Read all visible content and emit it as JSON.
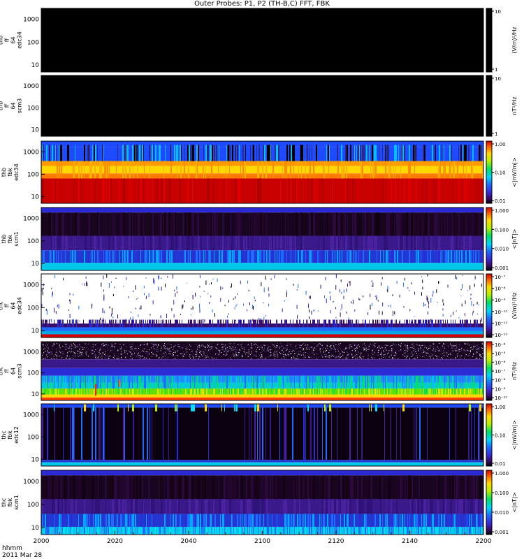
{
  "page": {
    "title": "Outer Probes: P1, P2 (TH-B,C) FFT, FBK"
  },
  "footer": {
    "hhmm_label": "hhmm",
    "date_label": "2011 Mar 28"
  },
  "chart_data": {
    "type": "heatmap",
    "x": {
      "label": "hhmm",
      "ticks": [
        "2000",
        "2020",
        "2040",
        "2100",
        "2120",
        "2140",
        "2200"
      ],
      "range_minutes": [
        0,
        120
      ]
    },
    "panels": [
      {
        "id": "tha-ff-edc34",
        "ylabel": [
          "thb",
          "ff",
          "64",
          "edc34"
        ],
        "yticks": [
          "1000",
          "100",
          "10"
        ],
        "ylog": true,
        "colorbar_label": "(V/m)²/Hz",
        "colorbar_ticks": [
          "10",
          "1"
        ],
        "colorbar_palette": "black",
        "style": "empty"
      },
      {
        "id": "thb-ff-scm3",
        "ylabel": [
          "thb",
          "ff",
          "64",
          "scm3"
        ],
        "yticks": [
          "1000",
          "100",
          "10"
        ],
        "ylog": true,
        "colorbar_label": "nT²/Hz",
        "colorbar_ticks": [
          "10",
          "1"
        ],
        "colorbar_palette": "black",
        "style": "empty"
      },
      {
        "id": "thb-fbk-edc34",
        "ylabel": [
          "thb",
          "fbk",
          "edc34"
        ],
        "yticks": [
          "1000",
          "100",
          "10"
        ],
        "ylog": true,
        "colorbar_label": "<|mV/m|>",
        "colorbar_ticks": [
          "1.00",
          "0.10",
          "0.01"
        ],
        "colorbar_palette": "rainbow",
        "style": "fbk_e",
        "bands": [
          {
            "name": "top",
            "color": "#1e4bff"
          },
          {
            "name": "stripe",
            "color": "#00c0ff"
          },
          {
            "name": "mid",
            "color": "#ff9a00"
          },
          {
            "name": "upper-mid",
            "color": "#ffd800"
          },
          {
            "name": "low",
            "color": "#d40000"
          }
        ]
      },
      {
        "id": "thb-fbk-scm1",
        "ylabel": [
          "thb",
          "fbk",
          "scm1"
        ],
        "yticks": [
          "1000",
          "100",
          "10"
        ],
        "ylog": true,
        "colorbar_label": "<|nT|>",
        "colorbar_ticks": [
          "1.000",
          "0.100",
          "0.010",
          "0.001"
        ],
        "colorbar_palette": "rainbow",
        "style": "fbk_b"
      },
      {
        "id": "thc-ff-edc34",
        "ylabel": [
          "thc",
          "ff",
          "64",
          "edc34"
        ],
        "yticks": [
          "1000",
          "100",
          "10"
        ],
        "ylog": true,
        "colorbar_label": "(V/m)²/Hz",
        "colorbar_ticks": [
          "10⁻⁷",
          "10⁻⁸",
          "10⁻⁹",
          "10⁻¹⁰",
          "10⁻¹¹",
          "10⁻¹²"
        ],
        "colorbar_palette": "rainbow",
        "style": "ff_e"
      },
      {
        "id": "thc-ff-scm3",
        "ylabel": [
          "thc",
          "ff",
          "64",
          "scm3"
        ],
        "yticks": [
          "1000",
          "100",
          "10"
        ],
        "ylog": true,
        "colorbar_label": "nT²/Hz",
        "colorbar_ticks": [
          "10⁻⁴",
          "10⁻⁵",
          "10⁻⁶",
          "10⁻⁷",
          "10⁻⁸",
          "10⁻⁹",
          "10⁻¹⁰"
        ],
        "colorbar_palette": "rainbow",
        "style": "ff_b"
      },
      {
        "id": "thc-fbk-edc12",
        "ylabel": [
          "thc",
          "fbk",
          "edc12"
        ],
        "yticks": [
          "1000",
          "100",
          "10"
        ],
        "ylog": true,
        "colorbar_label": "<|mV/m|>",
        "colorbar_ticks": [
          "1.00",
          "0.10",
          "0.01"
        ],
        "colorbar_palette": "rainbow",
        "style": "fbk_c"
      },
      {
        "id": "thc-fbk-scm1",
        "ylabel": [
          "thc",
          "fbk",
          "scm1"
        ],
        "yticks": [
          "1000",
          "100",
          "10"
        ],
        "ylog": true,
        "colorbar_label": "<|nT|>",
        "colorbar_ticks": [
          "1.000",
          "0.100",
          "0.010",
          "0.001"
        ],
        "colorbar_palette": "rainbow",
        "style": "fbk_b2"
      }
    ]
  }
}
